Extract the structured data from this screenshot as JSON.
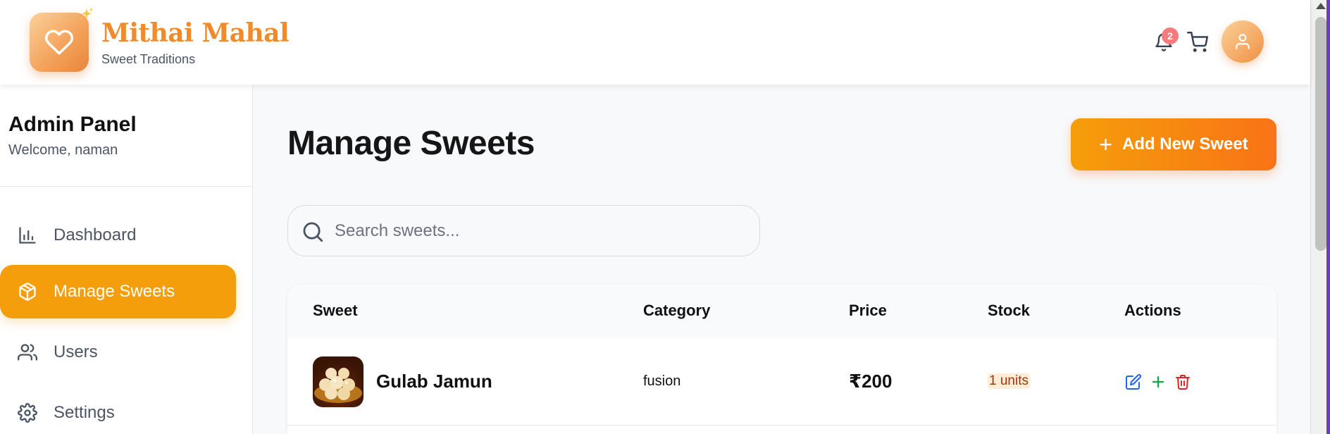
{
  "brand": {
    "title": "Mithai Mahal",
    "subtitle": "Sweet Traditions"
  },
  "header": {
    "notification_count": "2",
    "icons": [
      "bell-icon",
      "cart-icon",
      "user-icon"
    ]
  },
  "sidebar": {
    "title": "Admin Panel",
    "welcome": "Welcome, naman",
    "items": [
      {
        "label": "Dashboard",
        "icon": "bar-chart-icon",
        "active": false
      },
      {
        "label": "Manage Sweets",
        "icon": "package-icon",
        "active": true
      },
      {
        "label": "Users",
        "icon": "users-icon",
        "active": false
      },
      {
        "label": "Settings",
        "icon": "gear-icon",
        "active": false
      }
    ]
  },
  "main": {
    "title": "Manage Sweets",
    "add_button": "Add New Sweet",
    "search": {
      "placeholder": "Search sweets...",
      "value": ""
    },
    "table": {
      "columns": [
        "Sweet",
        "Category",
        "Price",
        "Stock",
        "Actions"
      ],
      "rows": [
        {
          "name": "Gulab Jamun",
          "category": "fusion",
          "price": "₹200",
          "stock": "1 units"
        }
      ]
    }
  },
  "colors": {
    "accent": "#f59e0b",
    "accent_end": "#f97316",
    "brand_text": "#f08a2a",
    "edit": "#2563eb",
    "restock": "#16a34a",
    "delete": "#dc2626"
  }
}
